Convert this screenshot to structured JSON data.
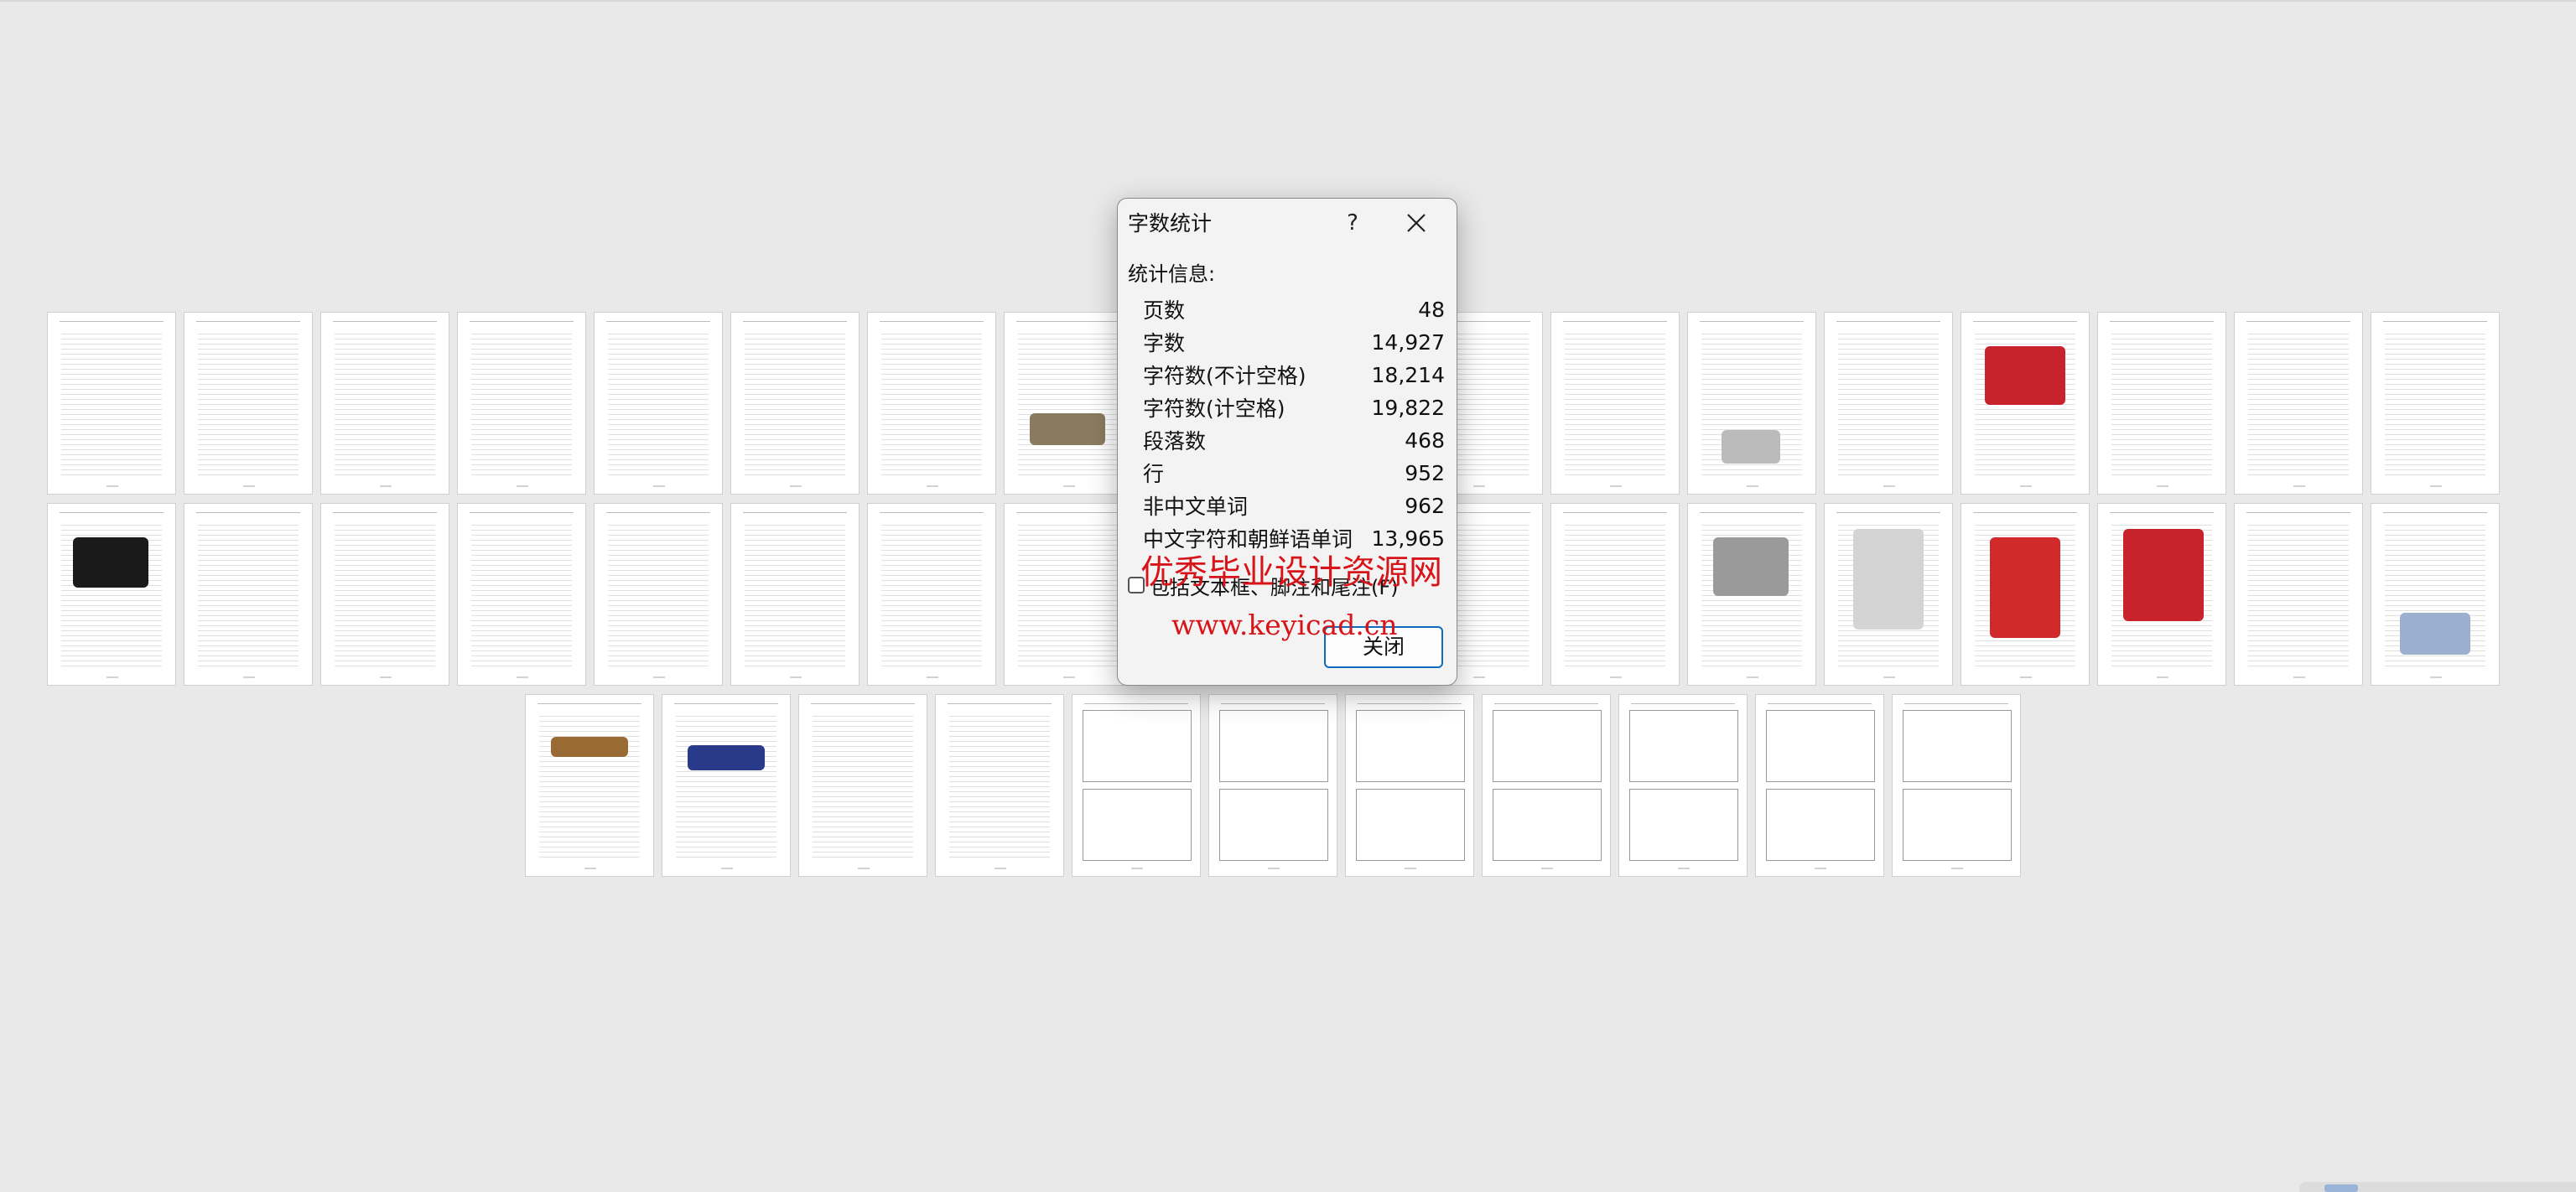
{
  "dialog": {
    "title": "字数统计",
    "help_label": "?",
    "stats_label": "统计信息:",
    "stats": [
      {
        "label": "页数",
        "value": "48"
      },
      {
        "label": "字数",
        "value": "14,927"
      },
      {
        "label": "字符数(不计空格)",
        "value": "18,214"
      },
      {
        "label": "字符数(计空格)",
        "value": "19,822"
      },
      {
        "label": "段落数",
        "value": "468"
      },
      {
        "label": "行",
        "value": "952"
      },
      {
        "label": "非中文单词",
        "value": "962"
      },
      {
        "label": "中文字符和朝鲜语单词",
        "value": "13,965"
      }
    ],
    "include_textboxes_label": "包括文本框、脚注和尾注(F)",
    "include_textboxes_checked": false,
    "close_button_label": "关闭"
  },
  "watermark": {
    "text_cn": "优秀毕业设计资源网",
    "url": "www.keyicad.cn",
    "color": "#d7141a"
  },
  "document": {
    "page_count": 48
  },
  "colors": {
    "accent": "#0f6cbd",
    "background": "#e9e9e9"
  }
}
